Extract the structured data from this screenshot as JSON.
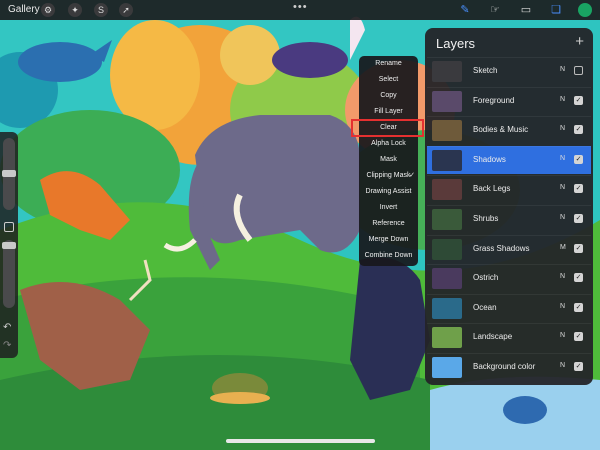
{
  "toolbar": {
    "gallery_label": "Gallery",
    "left_icons": [
      "wrench-icon",
      "magic-wand-icon",
      "selection-icon",
      "transform-arrow-icon"
    ],
    "more_label": "•••",
    "right_tools": [
      "brush-icon",
      "smudge-icon",
      "eraser-icon",
      "layers-icon"
    ],
    "current_color": "#19a463"
  },
  "context_menu": {
    "items": [
      {
        "label": "Rename"
      },
      {
        "label": "Select"
      },
      {
        "label": "Copy"
      },
      {
        "label": "Fill Layer"
      },
      {
        "label": "Clear"
      },
      {
        "label": "Alpha Lock"
      },
      {
        "label": "Mask"
      },
      {
        "label": "Clipping Mask",
        "checked": true
      },
      {
        "label": "Drawing Assist"
      },
      {
        "label": "Invert"
      },
      {
        "label": "Reference"
      },
      {
        "label": "Merge Down"
      },
      {
        "label": "Combine Down"
      }
    ],
    "highlighted": "Clear",
    "highlight_color": "#e53030"
  },
  "layers_panel": {
    "title": "Layers",
    "add_label": "+",
    "accent": "#2f6fe0",
    "layers": [
      {
        "name": "Sketch",
        "blend": "N",
        "visible": false,
        "selected": false,
        "thumb": "#3a3a3e"
      },
      {
        "name": "Foreground",
        "blend": "N",
        "visible": true,
        "selected": false,
        "thumb": "#5a4a6a"
      },
      {
        "name": "Bodies & Music",
        "blend": "N",
        "visible": true,
        "selected": false,
        "thumb": "#6e5a3a"
      },
      {
        "name": "Shadows",
        "blend": "N",
        "visible": true,
        "selected": true,
        "thumb": "#2a3550"
      },
      {
        "name": "Back Legs",
        "blend": "N",
        "visible": true,
        "selected": false,
        "thumb": "#5a3a3a"
      },
      {
        "name": "Shrubs",
        "blend": "N",
        "visible": true,
        "selected": false,
        "thumb": "#3a5a3a"
      },
      {
        "name": "Grass Shadows",
        "blend": "M",
        "visible": true,
        "selected": false,
        "thumb": "#2e4a36"
      },
      {
        "name": "Ostrich",
        "blend": "N",
        "visible": true,
        "selected": false,
        "thumb": "#4a3a5e"
      },
      {
        "name": "Ocean",
        "blend": "N",
        "visible": true,
        "selected": false,
        "thumb": "#2a6a8a"
      },
      {
        "name": "Landscape",
        "blend": "N",
        "visible": true,
        "selected": false,
        "thumb": "#6fa04a"
      },
      {
        "name": "Background color",
        "blend": "N",
        "visible": true,
        "selected": false,
        "thumb": "#5aa8e8"
      }
    ]
  }
}
